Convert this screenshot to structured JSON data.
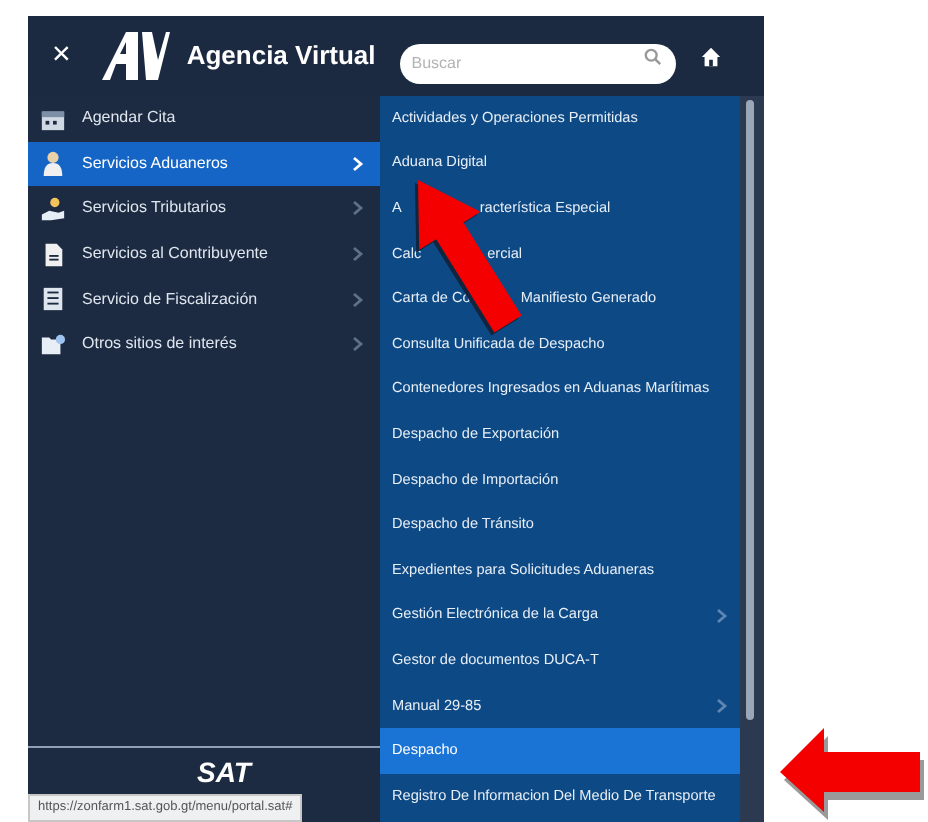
{
  "header": {
    "close": "×",
    "title": "Agencia Virtual",
    "search": {
      "placeholder": "Buscar"
    }
  },
  "menu": [
    {
      "label": "Agendar Cita",
      "selected": false,
      "has_submenu": false
    },
    {
      "label": "Servicios Aduaneros",
      "selected": true,
      "has_submenu": true
    },
    {
      "label": "Servicios Tributarios",
      "selected": false,
      "has_submenu": true
    },
    {
      "label": "Servicios al Contribuyente",
      "selected": false,
      "has_submenu": true
    },
    {
      "label": "Servicio de Fiscalización",
      "selected": false,
      "has_submenu": true
    },
    {
      "label": "Otros sitios de interés",
      "selected": false,
      "has_submenu": true
    }
  ],
  "submenu": [
    {
      "parts": [
        "Actividades y Operaciones Permitidas"
      ],
      "selected": false,
      "has_submenu": false
    },
    {
      "parts": [
        "Aduana Digital"
      ],
      "selected": false,
      "has_submenu": false
    },
    {
      "parts": [
        "A",
        "racterística Especial"
      ],
      "selected": false,
      "has_submenu": false
    },
    {
      "parts": [
        "Calc",
        "ercial"
      ],
      "selected": false,
      "has_submenu": false
    },
    {
      "parts": [
        "Carta de Co",
        "Manifiesto Generado"
      ],
      "selected": false,
      "has_submenu": false
    },
    {
      "parts": [
        "Consulta Unificada de Despacho"
      ],
      "selected": false,
      "has_submenu": false
    },
    {
      "parts": [
        "Contenedores Ingresados en Aduanas Marítimas"
      ],
      "selected": false,
      "has_submenu": false
    },
    {
      "parts": [
        "Despacho de Exportación"
      ],
      "selected": false,
      "has_submenu": false
    },
    {
      "parts": [
        "Despacho de Importación"
      ],
      "selected": false,
      "has_submenu": false
    },
    {
      "parts": [
        "Despacho de Tránsito"
      ],
      "selected": false,
      "has_submenu": false
    },
    {
      "parts": [
        "Expedientes para Solicitudes Aduaneras"
      ],
      "selected": false,
      "has_submenu": false
    },
    {
      "parts": [
        "Gestión Electrónica de la Carga"
      ],
      "selected": false,
      "has_submenu": true
    },
    {
      "parts": [
        "Gestor de documentos DUCA-T"
      ],
      "selected": false,
      "has_submenu": false
    },
    {
      "parts": [
        "Manual 29-85"
      ],
      "selected": false,
      "has_submenu": true
    },
    {
      "parts": [
        "Despacho"
      ],
      "selected": true,
      "has_submenu": false
    },
    {
      "parts": [
        "Registro De Informacion Del Medio De Transporte"
      ],
      "selected": false,
      "has_submenu": false
    }
  ],
  "footer": {
    "logo": "SAT"
  },
  "status_url": "https://zonfarm1.sat.gob.gt/menu/portal.sat#"
}
